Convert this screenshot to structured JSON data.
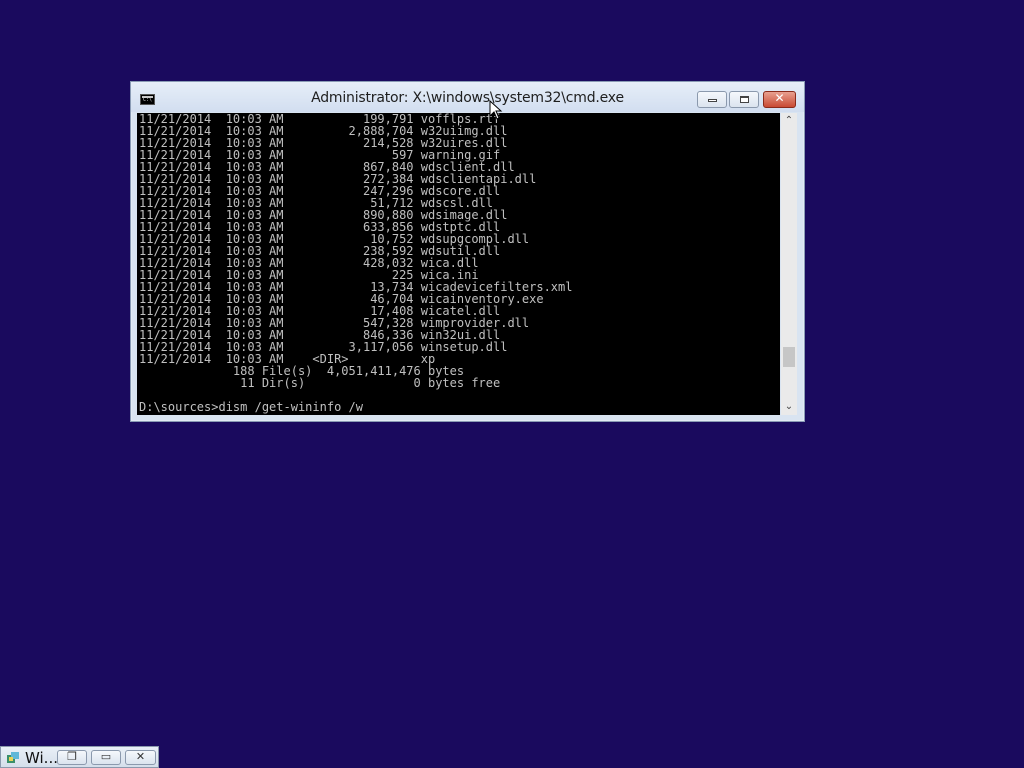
{
  "window": {
    "title": "Administrator: X:\\windows\\system32\\cmd.exe",
    "icon": "console-icon"
  },
  "console": {
    "lines": [
      "11/21/2014  10:03 AM           199,791 vofflps.rtf",
      "11/21/2014  10:03 AM         2,888,704 w32uiimg.dll",
      "11/21/2014  10:03 AM           214,528 w32uires.dll",
      "11/21/2014  10:03 AM               597 warning.gif",
      "11/21/2014  10:03 AM           867,840 wdsclient.dll",
      "11/21/2014  10:03 AM           272,384 wdsclientapi.dll",
      "11/21/2014  10:03 AM           247,296 wdscore.dll",
      "11/21/2014  10:03 AM            51,712 wdscsl.dll",
      "11/21/2014  10:03 AM           890,880 wdsimage.dll",
      "11/21/2014  10:03 AM           633,856 wdstptc.dll",
      "11/21/2014  10:03 AM            10,752 wdsupgcompl.dll",
      "11/21/2014  10:03 AM           238,592 wdsutil.dll",
      "11/21/2014  10:03 AM           428,032 wica.dll",
      "11/21/2014  10:03 AM               225 wica.ini",
      "11/21/2014  10:03 AM            13,734 wicadevicefilters.xml",
      "11/21/2014  10:03 AM            46,704 wicainventory.exe",
      "11/21/2014  10:03 AM            17,408 wicatel.dll",
      "11/21/2014  10:03 AM           547,328 wimprovider.dll",
      "11/21/2014  10:03 AM           846,336 win32ui.dll",
      "11/21/2014  10:03 AM         3,117,056 winsetup.dll",
      "11/21/2014  10:03 AM    <DIR>          xp",
      "             188 File(s)  4,051,411,476 bytes",
      "              11 Dir(s)               0 bytes free",
      "",
      "D:\\sources>dism /get-wininfo /w"
    ]
  },
  "taskbar_tile": {
    "label": "Wi...",
    "icon": "setup-icon"
  },
  "colors": {
    "desktop": "#1a0a5e",
    "console_bg": "#000000",
    "console_fg": "#c0c0c0",
    "close_button": "#c94a32"
  }
}
